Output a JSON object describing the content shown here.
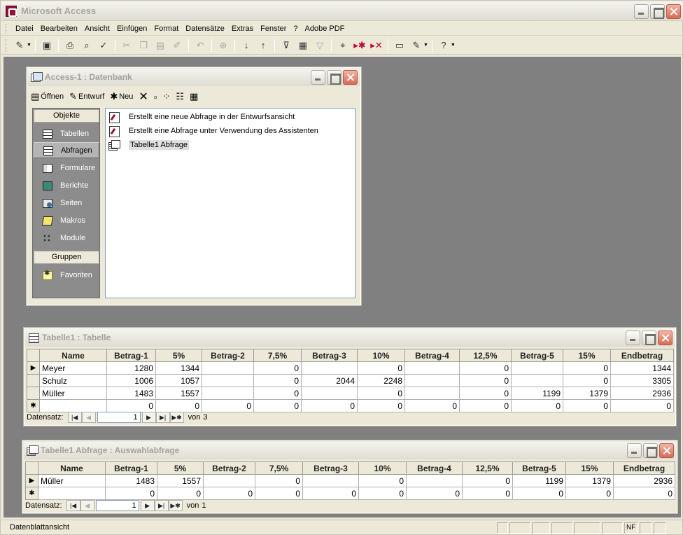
{
  "app": {
    "title": "Microsoft Access",
    "accent_color": "#8a1538",
    "mdi_background": "#808080"
  },
  "menu": [
    {
      "label": "Datei",
      "icon": ""
    },
    {
      "label": "Bearbeiten"
    },
    {
      "label": "Ansicht"
    },
    {
      "label": "Einfügen"
    },
    {
      "label": "Format"
    },
    {
      "label": "Datensätze"
    },
    {
      "label": "Extras"
    },
    {
      "label": "Fenster"
    },
    {
      "label": "?"
    },
    {
      "label": "Adobe PDF"
    }
  ],
  "toolbar": {
    "icons": [
      "design-view-icon",
      "save-icon",
      "print-icon",
      "print-preview-icon",
      "spelling-icon",
      "cut-icon",
      "copy-icon",
      "paste-icon",
      "format-painter-icon",
      "undo-icon",
      "hyperlink-icon",
      "sort-ascending-icon",
      "sort-descending-icon",
      "filter-by-selection-icon",
      "filter-by-form-icon",
      "apply-filter-icon",
      "find-icon",
      "new-record-icon",
      "delete-record-icon",
      "database-window-icon",
      "new-object-icon",
      "help-icon"
    ]
  },
  "db_window": {
    "title": "Access-1 : Datenbank",
    "toolbar": {
      "open_label": "Öffnen",
      "design_label": "Entwurf",
      "new_label": "Neu"
    },
    "objects_header": "Objekte",
    "groups_header": "Gruppen",
    "nav_items": [
      {
        "label": "Tabellen",
        "icon": "table-icon"
      },
      {
        "label": "Abfragen",
        "icon": "query-icon",
        "selected": true
      },
      {
        "label": "Formulare",
        "icon": "form-icon"
      },
      {
        "label": "Berichte",
        "icon": "report-icon"
      },
      {
        "label": "Seiten",
        "icon": "page-icon"
      },
      {
        "label": "Makros",
        "icon": "macro-icon"
      },
      {
        "label": "Module",
        "icon": "module-icon"
      }
    ],
    "favorites_label": "Favoriten",
    "list": [
      {
        "label": "Erstellt eine neue Abfrage in der Entwurfsansicht",
        "icon": "wizard-icon"
      },
      {
        "label": "Erstellt eine Abfrage unter Verwendung des Assistenten",
        "icon": "wizard-icon"
      },
      {
        "label": "Tabelle1 Abfrage",
        "icon": "query-icon",
        "selected": true
      }
    ]
  },
  "table_window": {
    "title": "Tabelle1 : Tabelle",
    "columns": [
      "Name",
      "Betrag-1",
      "5%",
      "Betrag-2",
      "7,5%",
      "Betrag-3",
      "10%",
      "Betrag-4",
      "12,5%",
      "Betrag-5",
      "15%",
      "Endbetrag"
    ],
    "rows": [
      [
        "Meyer",
        "1280",
        "1344",
        "",
        "0",
        "",
        "0",
        "",
        "0",
        "",
        "0",
        "1344"
      ],
      [
        "Schulz",
        "1006",
        "1057",
        "",
        "0",
        "2044",
        "2248",
        "",
        "0",
        "",
        "0",
        "3305"
      ],
      [
        "Müller",
        "1483",
        "1557",
        "",
        "0",
        "",
        "0",
        "",
        "0",
        "1199",
        "1379",
        "2936"
      ]
    ],
    "new_row": [
      "",
      "0",
      "0",
      "0",
      "0",
      "0",
      "0",
      "0",
      "0",
      "0",
      "0",
      "0"
    ],
    "nav": {
      "label": "Datensatz:",
      "current": "1",
      "of_label": "von",
      "total": "3"
    }
  },
  "query_window": {
    "title": "Tabelle1 Abfrage : Auswahlabfrage",
    "columns": [
      "Name",
      "Betrag-1",
      "5%",
      "Betrag-2",
      "7,5%",
      "Betrag-3",
      "10%",
      "Betrag-4",
      "12,5%",
      "Betrag-5",
      "15%",
      "Endbetrag"
    ],
    "rows": [
      [
        "Müller",
        "1483",
        "1557",
        "",
        "0",
        "",
        "0",
        "",
        "0",
        "1199",
        "1379",
        "2936"
      ]
    ],
    "new_row": [
      "",
      "0",
      "0",
      "0",
      "0",
      "0",
      "0",
      "0",
      "0",
      "0",
      "0",
      "0"
    ],
    "nav": {
      "label": "Datensatz:",
      "current": "1",
      "of_label": "von",
      "total": "1"
    }
  },
  "statusbar": {
    "text": "Datenblattansicht",
    "indicator": "NF"
  }
}
